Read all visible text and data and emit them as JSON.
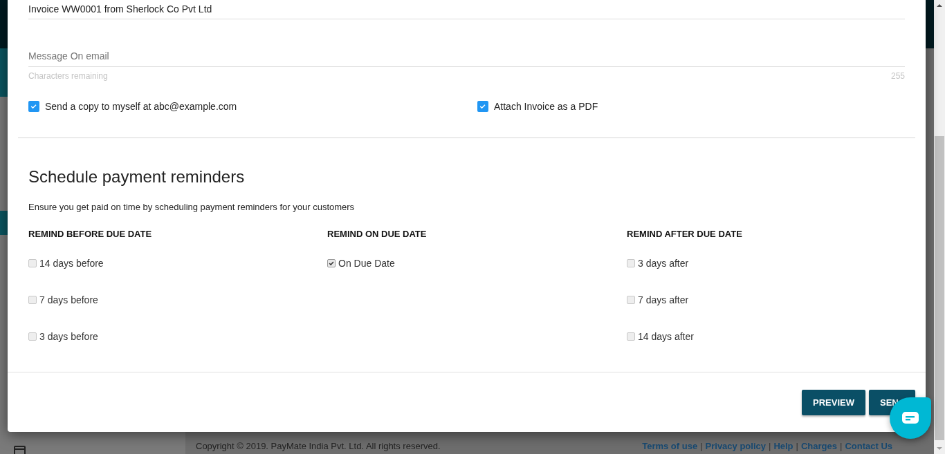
{
  "email": {
    "subject": "Invoice WW0001 from Sherlock Co Pvt Ltd",
    "message_placeholder": "Message On email",
    "counter_label": "Characters remaining",
    "counter": "255",
    "options": [
      {
        "label": "Send a copy to myself at abc@example.com",
        "checked": true
      },
      {
        "label": "Attach Invoice as a PDF",
        "checked": true
      }
    ]
  },
  "reminders": {
    "title": "Schedule payment reminders",
    "description": "Ensure you get paid on time by scheduling payment reminders for your customers",
    "groups": [
      {
        "heading": "REMIND BEFORE DUE DATE",
        "options": [
          {
            "label": "14 days before",
            "checked": false
          },
          {
            "label": "7 days before",
            "checked": false
          },
          {
            "label": "3 days before",
            "checked": false
          }
        ]
      },
      {
        "heading": "REMIND ON DUE DATE",
        "options": [
          {
            "label": "On Due Date",
            "checked": true
          }
        ]
      },
      {
        "heading": "REMIND AFTER DUE DATE",
        "options": [
          {
            "label": "3 days after",
            "checked": false
          },
          {
            "label": "7 days after",
            "checked": false
          },
          {
            "label": "14 days after",
            "checked": false
          }
        ]
      }
    ]
  },
  "buttons": [
    {
      "label": "PREVIEW"
    },
    {
      "label": "SEN"
    }
  ],
  "background": {
    "copyright": "Copyright © 2019. PayMate India Pvt. Ltd. All rights reserved.",
    "separator": "|",
    "footer_links": [
      "Terms of use",
      "Privacy policy",
      "Help",
      "Charges",
      "Contact Us"
    ]
  }
}
